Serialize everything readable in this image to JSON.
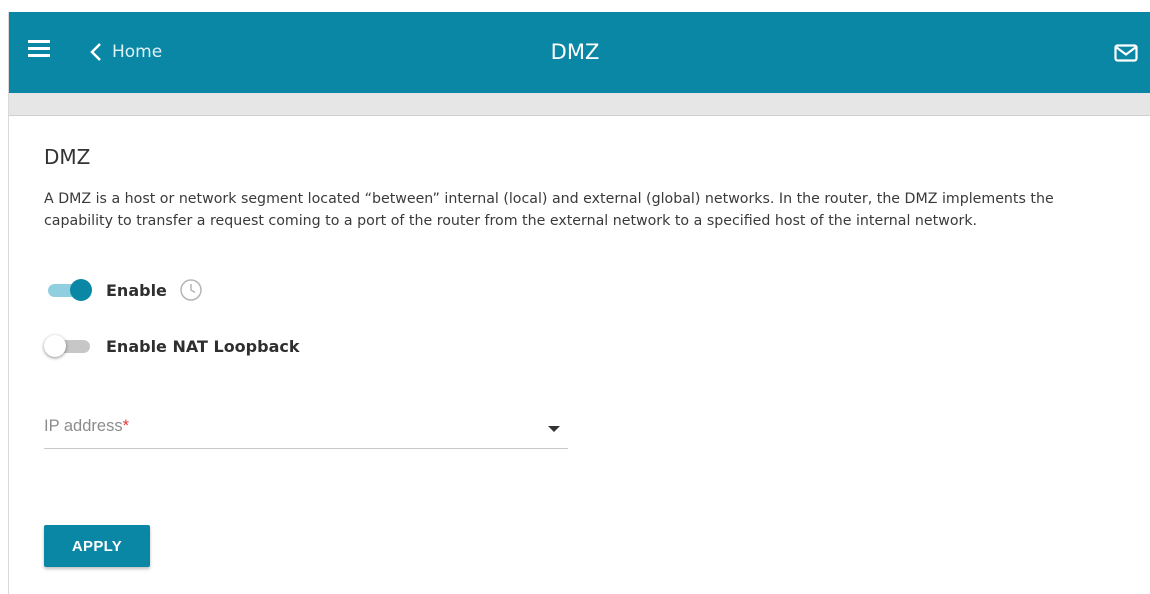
{
  "header": {
    "nav_back_label": "Home",
    "title": "DMZ",
    "menu_icon": "hamburger-menu-icon",
    "back_icon": "chevron-left-icon",
    "mail_icon": "mail-icon"
  },
  "section": {
    "title": "DMZ",
    "description": "A DMZ is a host or network segment located “between” internal (local) and external (global) networks. In the router, the DMZ implements the capability to transfer a request coming to a port of the router from the external network to a specified host of the internal network."
  },
  "toggles": [
    {
      "label": "Enable",
      "state": "on"
    },
    {
      "label": "Enable NAT Loopback",
      "state": "off"
    }
  ],
  "ip_field": {
    "placeholder": "IP address",
    "required_mark": "*",
    "value": ""
  },
  "apply_label": "APPLY",
  "colors": {
    "accent": "#0a87a4",
    "required": "#e53935"
  }
}
